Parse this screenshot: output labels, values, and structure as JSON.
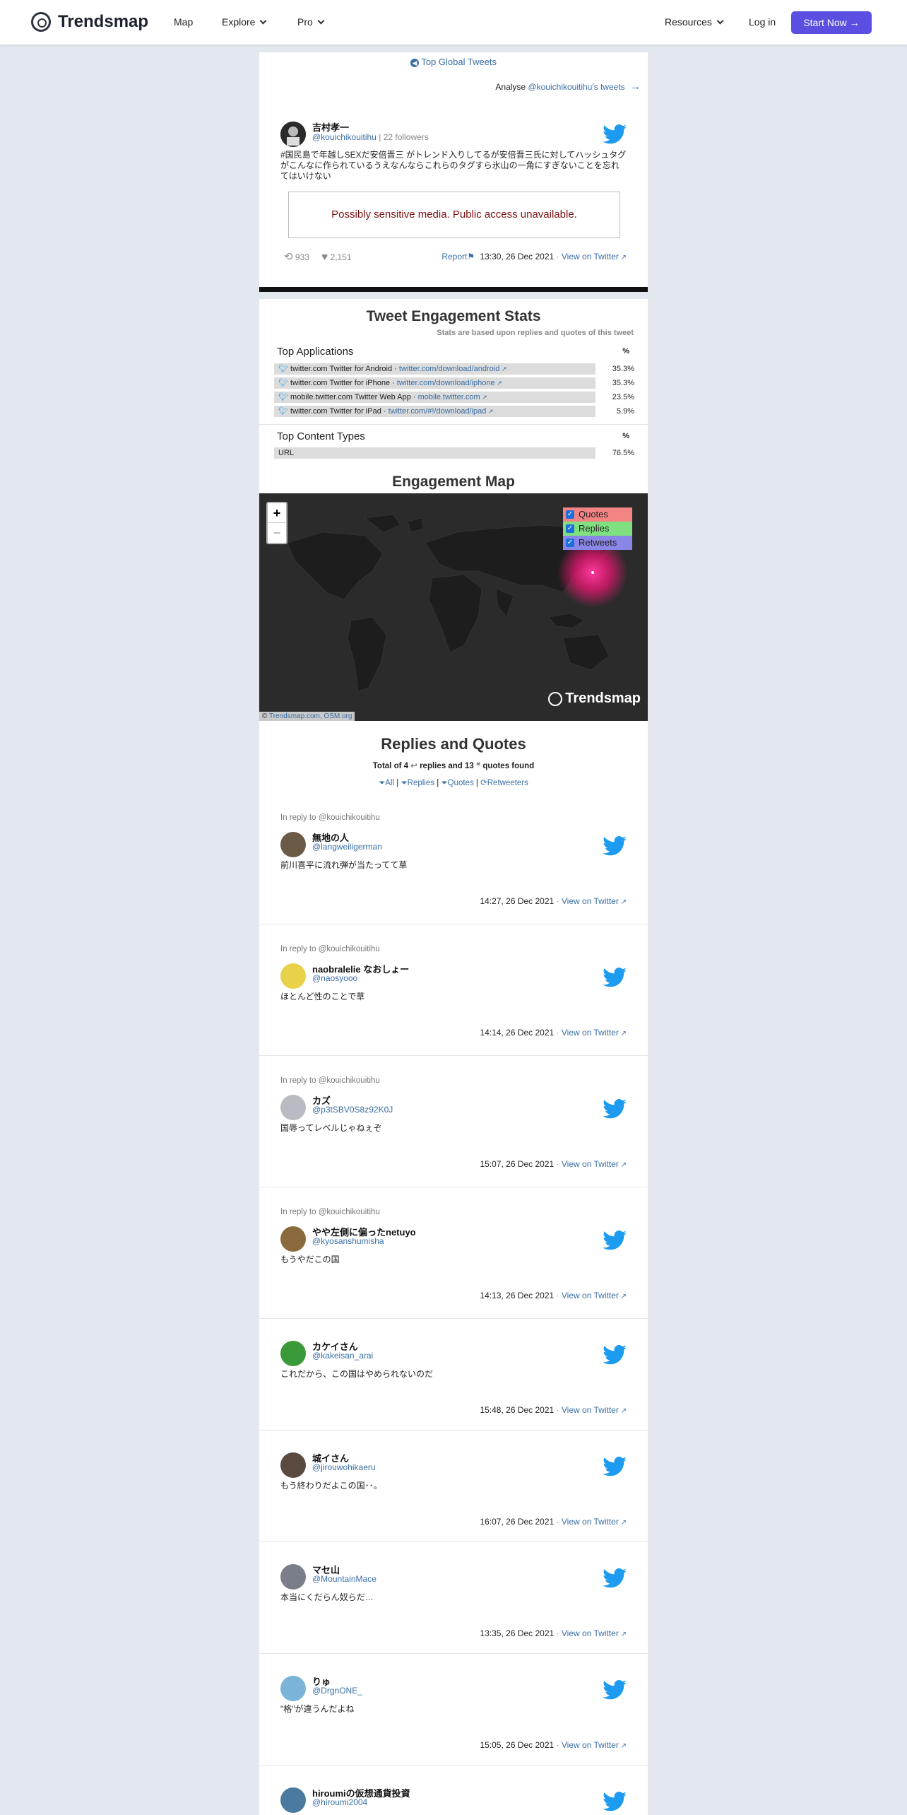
{
  "nav": {
    "brand": "Trendsmap",
    "map": "Map",
    "explore": "Explore",
    "pro": "Pro",
    "resources": "Resources",
    "login": "Log in",
    "start": "Start Now"
  },
  "top_link": "Top Global Tweets",
  "analyse": {
    "prefix": "Analyse",
    "link": "@kouichikouitihu's tweets"
  },
  "main_tweet": {
    "name": "吉村孝一",
    "handle": "@kouichikouitihu",
    "followers": "| 22 followers",
    "text": "#国民島で年越しSEXだ安倍晋三 がトレンド入りしてるが安倍晋三氏に対してハッシュタグがこんなに作られているうえなんならこれらのタグすら氷山の一角にすぎないことを忘れてはいけない",
    "sensitive": "Possibly sensitive media. Public access unavailable.",
    "retweets": "933",
    "likes": "2,151",
    "report": "Report",
    "time": "13:30, 26 Dec 2021",
    "view": "View on Twitter"
  },
  "stats": {
    "title": "Tweet Engagement Stats",
    "subtitle": "Stats are based upon replies and quotes of this tweet",
    "apps_header": "Top Applications",
    "pct_header": "%",
    "apps": [
      {
        "name": "twitter.com Twitter for Android ·",
        "link": "twitter.com/download/android",
        "pct": "35.3%",
        "fill": 0.353
      },
      {
        "name": "twitter.com Twitter for iPhone ·",
        "link": "twitter.com/download/iphone",
        "pct": "35.3%",
        "fill": 0.353
      },
      {
        "name": "mobile.twitter.com Twitter Web App ·",
        "link": "mobile.twitter.com",
        "pct": "23.5%",
        "fill": 0.235
      },
      {
        "name": "twitter.com Twitter for iPad ·",
        "link": "twitter.com/#!/download/ipad",
        "pct": "5.9%",
        "fill": 0.059
      }
    ],
    "content_header": "Top Content Types",
    "content_pct_header": "%",
    "content": [
      {
        "name": "URL",
        "pct": "76.5%",
        "fill": 0.765
      }
    ]
  },
  "map": {
    "title": "Engagement Map",
    "zoom_in": "+",
    "zoom_out": "−",
    "legend": [
      "Quotes",
      "Replies",
      "Retweets"
    ],
    "legend_colors": [
      "#f48484",
      "#7fe07f",
      "#8a86e8"
    ],
    "watermark": "Trendsmap",
    "attribution_prefix": "©",
    "attribution": "Trendsmap.com, OSM.org"
  },
  "replies": {
    "title": "Replies and Quotes",
    "summary_prefix": "Total of 4",
    "summary_mid": "replies and 13",
    "summary_suffix": "quotes found",
    "filters": [
      "All",
      "Replies",
      "Quotes",
      "Retweeters"
    ],
    "items": [
      {
        "reply_to": "In reply to @kouichikouitihu",
        "name": "無地の人",
        "handle": "@langweiligerman",
        "text": "前川喜平に流れ弾が当たってて草",
        "time": "14:27, 26 Dec 2021",
        "view": "View on Twitter",
        "avatar_color": "#6b5a45"
      },
      {
        "reply_to": "In reply to @kouichikouitihu",
        "name": "naobralelie なおしょー",
        "handle": "@naosyooo",
        "text": "ほとんど性のことで草",
        "time": "14:14, 26 Dec 2021",
        "view": "View on Twitter",
        "avatar_color": "#e8d24a"
      },
      {
        "reply_to": "In reply to @kouichikouitihu",
        "name": "カズ",
        "handle": "@p3tSBV0S8z92K0J",
        "text": "国辱ってレベルじゃねぇぞ",
        "time": "15:07, 26 Dec 2021",
        "view": "View on Twitter",
        "avatar_color": "#b8bcc2"
      },
      {
        "reply_to": "In reply to @kouichikouitihu",
        "name": "やや左側に偏ったnetuyo",
        "handle": "@kyosanshumisha",
        "text": "もうやだこの国⁣",
        "time": "14:13, 26 Dec 2021",
        "view": "View on Twitter",
        "avatar_color": "#8a6a3c"
      },
      {
        "reply_to": "",
        "name": "カケイさん",
        "handle": "@kakeisan_arai",
        "text": "これだから、この国はやめられないのだ",
        "time": "15:48, 26 Dec 2021",
        "view": "View on Twitter",
        "avatar_color": "#3a9a3a"
      },
      {
        "reply_to": "",
        "name": "城イさん",
        "handle": "@jirouwohikaeru",
        "text": "もう終わりだよこの国･･。",
        "time": "16:07, 26 Dec 2021",
        "view": "View on Twitter",
        "avatar_color": "#5a4a40"
      },
      {
        "reply_to": "",
        "name": "マセ山",
        "handle": "@MountainMace",
        "text": "本当にくだらん奴らだ…",
        "time": "13:35, 26 Dec 2021",
        "view": "View on Twitter",
        "avatar_color": "#7a7e8a"
      },
      {
        "reply_to": "",
        "name": "りゅ",
        "handle": "@DrgnONE_",
        "text": "\"格\"が違うんだよね",
        "time": "15:05, 26 Dec 2021",
        "view": "View on Twitter",
        "avatar_color": "#7ab4d8"
      },
      {
        "reply_to": "",
        "name": "hiroumiの仮想通貨投資",
        "handle": "@hiroumi2004",
        "text": "",
        "time": "",
        "view": "",
        "avatar_color": "#4a7aa0"
      }
    ]
  }
}
